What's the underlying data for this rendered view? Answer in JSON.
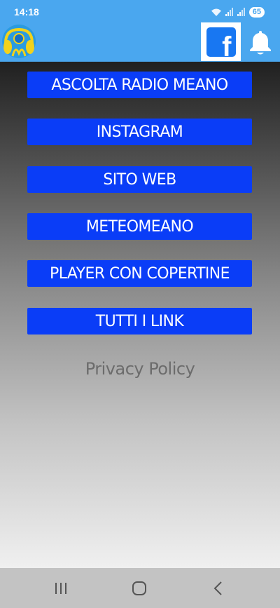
{
  "status_bar": {
    "time": "14:18",
    "battery": "65"
  },
  "app_bar": {
    "logo_icon": "radio-headphones-logo",
    "facebook_icon": "facebook-icon",
    "facebook_glyph": "f",
    "notifications_icon": "bell-icon"
  },
  "menu": {
    "items": [
      {
        "label": "ASCOLTA RADIO MEANO"
      },
      {
        "label": "INSTAGRAM"
      },
      {
        "label": "SITO WEB"
      },
      {
        "label": "METEOMEANO"
      },
      {
        "label": "PLAYER CON COPERTINE"
      },
      {
        "label": "TUTTI I LINK"
      }
    ],
    "privacy_label": "Privacy Policy"
  },
  "colors": {
    "app_bar": "#4aa7ef",
    "button": "#0a3df7",
    "facebook": "#1877f2",
    "privacy_text": "#6c6c6c",
    "nav_bar": "#c3c3c3"
  },
  "nav": {
    "recents_icon": "recents-icon",
    "home_icon": "home-icon",
    "back_icon": "back-icon"
  }
}
